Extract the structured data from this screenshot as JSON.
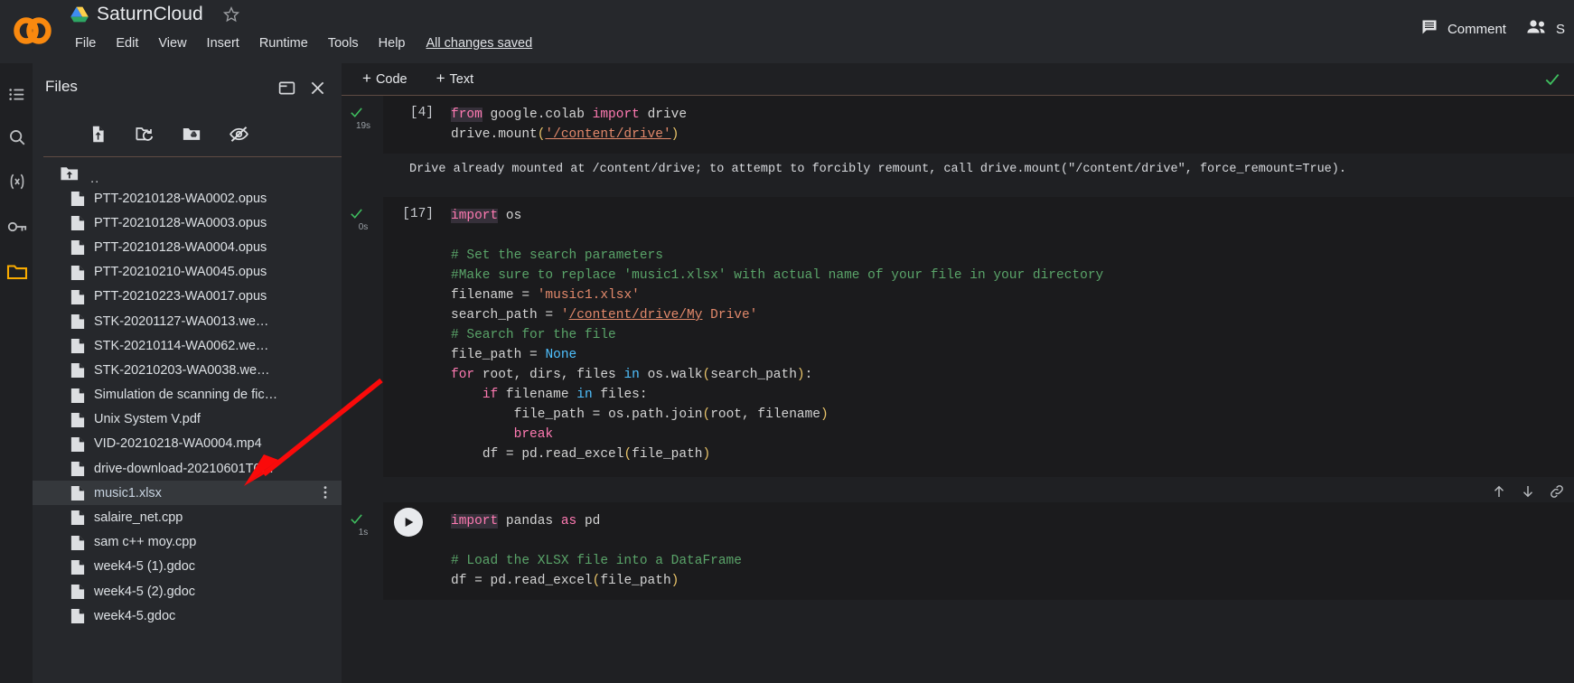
{
  "topbar": {
    "doc_title": "SaturnCloud",
    "menu": [
      "File",
      "Edit",
      "View",
      "Insert",
      "Runtime",
      "Tools",
      "Help"
    ],
    "save_status": "All changes saved",
    "comment_label": "Comment",
    "share_label": "S",
    "logo_name": "colab-logo",
    "drive_icon": "drive-icon",
    "star_icon": "star-outline-icon",
    "comment_icon": "comment-icon",
    "share_icon": "people-icon"
  },
  "rail": {
    "items": [
      {
        "name": "table-of-contents-icon",
        "label": "Table of contents"
      },
      {
        "name": "search-icon",
        "label": "Find and replace"
      },
      {
        "name": "variables-icon",
        "label": "Variables"
      },
      {
        "name": "secrets-key-icon",
        "label": "Secrets"
      },
      {
        "name": "files-folder-icon",
        "label": "Files"
      }
    ]
  },
  "files_panel": {
    "title": "Files",
    "header_buttons": [
      {
        "name": "open-in-new-window-icon",
        "label": "Open in new window"
      },
      {
        "name": "close-icon",
        "label": "Close"
      }
    ],
    "toolbar": [
      {
        "name": "upload-file-icon",
        "label": "Upload to session storage"
      },
      {
        "name": "refresh-folder-icon",
        "label": "Refresh"
      },
      {
        "name": "mount-drive-icon",
        "label": "Mount Drive"
      },
      {
        "name": "hide-hidden-files-icon",
        "label": "Show/hide hidden files"
      }
    ],
    "parent_dir": "..",
    "parent_icon": "folder-up-icon",
    "selected_file": "music1.xlsx",
    "files": [
      {
        "name": "PTT-20210128-WA0002.opus",
        "selected": false
      },
      {
        "name": "PTT-20210128-WA0003.opus",
        "selected": false
      },
      {
        "name": "PTT-20210128-WA0004.opus",
        "selected": false
      },
      {
        "name": "PTT-20210210-WA0045.opus",
        "selected": false
      },
      {
        "name": "PTT-20210223-WA0017.opus",
        "selected": false
      },
      {
        "name": "STK-20201127-WA0013.we…",
        "selected": false
      },
      {
        "name": "STK-20210114-WA0062.we…",
        "selected": false
      },
      {
        "name": "STK-20210203-WA0038.we…",
        "selected": false
      },
      {
        "name": "Simulation de scanning de fic…",
        "selected": false
      },
      {
        "name": "Unix System V.pdf",
        "selected": false
      },
      {
        "name": "VID-20210218-WA0004.mp4",
        "selected": false
      },
      {
        "name": "drive-download-20210601T0…",
        "selected": false
      },
      {
        "name": "music1.xlsx",
        "selected": true
      },
      {
        "name": "salaire_net.cpp",
        "selected": false
      },
      {
        "name": "sam c++ moy.cpp",
        "selected": false
      },
      {
        "name": "week4-5 (1).gdoc",
        "selected": false
      },
      {
        "name": "week4-5 (2).gdoc",
        "selected": false
      },
      {
        "name": "week4-5.gdoc",
        "selected": false
      }
    ]
  },
  "notebook": {
    "add_code_label": "Code",
    "add_text_label": "Text",
    "plus_symbol": "+",
    "status_check_icon": "check-icon",
    "cells": [
      {
        "exec_count": "[4]",
        "runtime": "19s",
        "status_icon": "check-icon",
        "output": "Drive already mounted at /content/drive; to attempt to forcibly remount, call drive.mount(\"/content/drive\", force_remount=True)."
      },
      {
        "exec_count": "[17]",
        "runtime": "0s",
        "status_icon": "check-icon"
      },
      {
        "exec_count": "",
        "runtime": "1s",
        "status_icon": "check-icon",
        "play_icon": "play-icon"
      }
    ],
    "cell_actions": [
      {
        "name": "move-cell-up-icon"
      },
      {
        "name": "move-cell-down-icon"
      },
      {
        "name": "link-to-cell-icon"
      }
    ]
  },
  "annotation": {
    "arrow_color": "#fa0a0a",
    "arrow_name": "red-pointer-arrow"
  },
  "colors": {
    "topbar_bg": "#26282c",
    "panel_bg": "#26282c",
    "editor_bg": "#1b1b1d",
    "page_bg": "#1f2023",
    "accent_orange": "#f9ab00",
    "selected_row": "#35383c"
  }
}
